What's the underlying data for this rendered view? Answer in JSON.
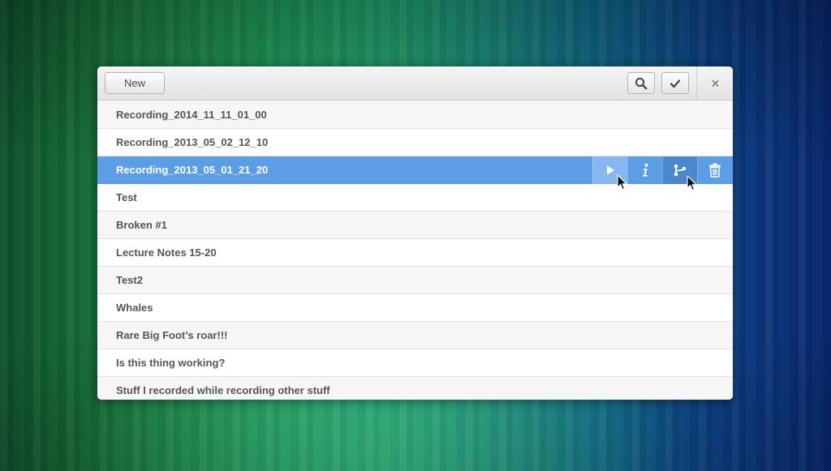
{
  "toolbar": {
    "new_label": "New",
    "search_icon": "search-icon",
    "done_icon": "checkmark-icon",
    "close_icon": "close-icon",
    "close_glyph": "✕"
  },
  "recordings": [
    {
      "name": "Recording_2014_11_11_01_00"
    },
    {
      "name": "Recording_2013_05_02_12_10"
    },
    {
      "name": "Recording_2013_05_01_21_20",
      "selected": true
    },
    {
      "name": "Test"
    },
    {
      "name": "Broken #1"
    },
    {
      "name": "Lecture Notes 15-20"
    },
    {
      "name": "Test2"
    },
    {
      "name": "Whales"
    },
    {
      "name": "Rare Big Foot’s roar!!!"
    },
    {
      "name": "Is this thing working?"
    },
    {
      "name": "Stuff I recorded while recording other stuff"
    }
  ],
  "row_actions": [
    {
      "icon": "play-icon"
    },
    {
      "icon": "info-icon"
    },
    {
      "icon": "export-icon"
    },
    {
      "icon": "trash-icon"
    }
  ],
  "colors": {
    "selection": "#5b9ee6",
    "row_text": "#555555"
  }
}
